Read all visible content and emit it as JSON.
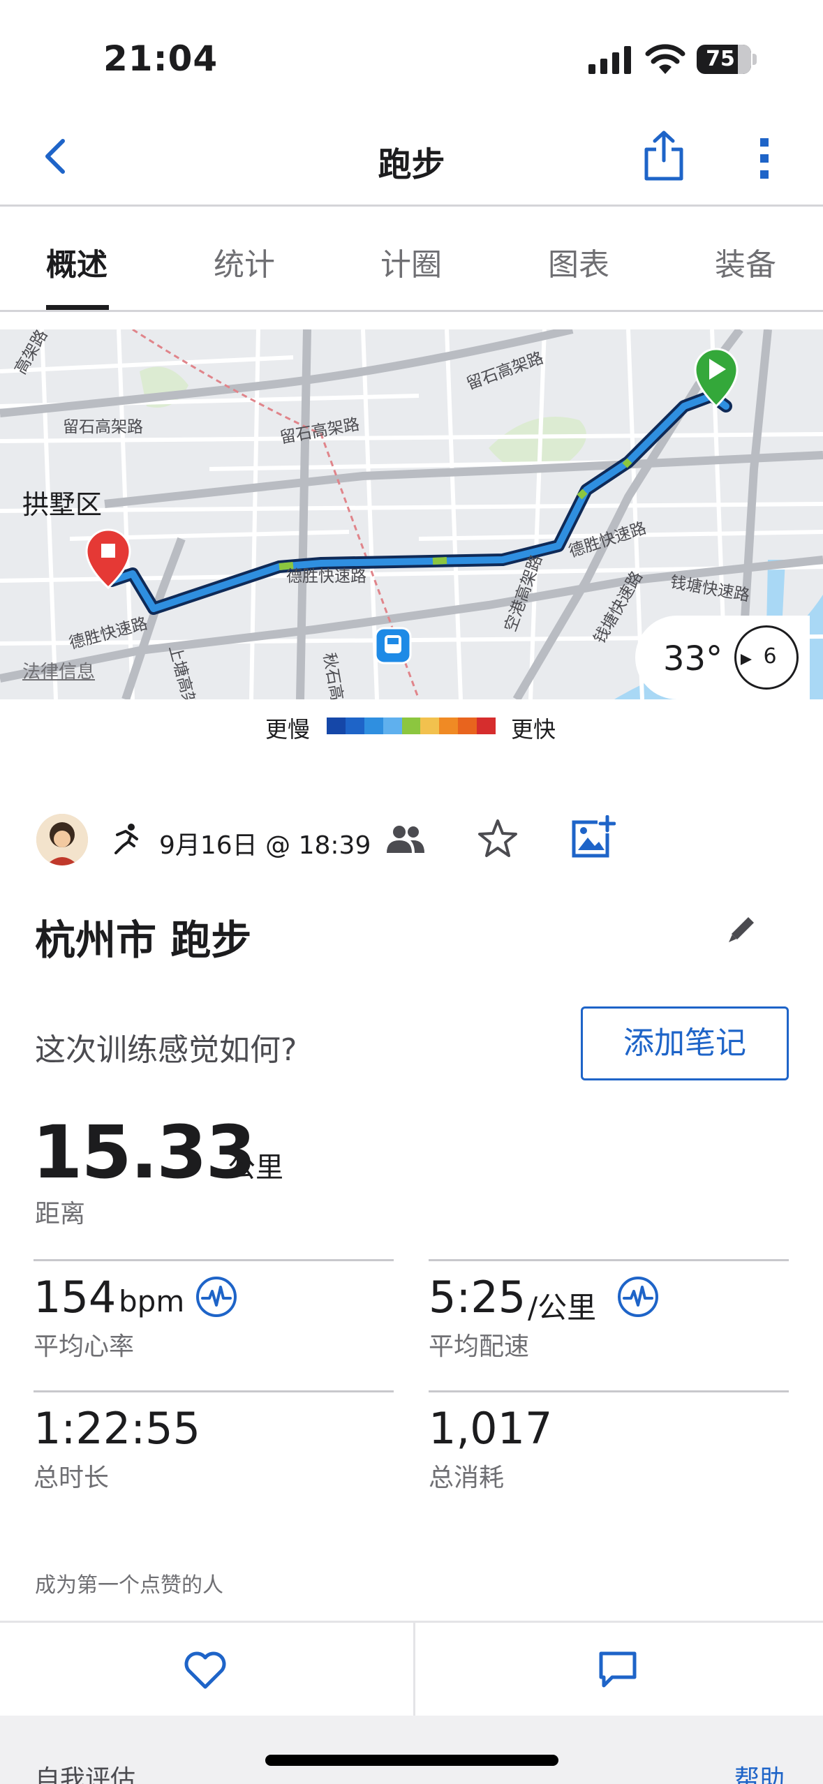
{
  "status_bar": {
    "time": "21:04",
    "battery": "75",
    "battery_level": 0.75
  },
  "nav": {
    "title": "跑步"
  },
  "tabs": [
    "概述",
    "统计",
    "计圈",
    "图表",
    "装备"
  ],
  "map": {
    "district": "拱墅区",
    "legal": "法律信息",
    "roads": [
      "留石高架路",
      "留石高架路",
      "留石高架路",
      "德胜快速路",
      "德胜快速路",
      "德胜快速路",
      "钱塘快速路",
      "钱塘快速路",
      "空港高架路",
      "上塘高架",
      "秋石高",
      "高架路"
    ],
    "weather_temp": "33°",
    "wind_speed": "6"
  },
  "legend": {
    "slow": "更慢",
    "fast": "更快",
    "colors": [
      "#1547a8",
      "#1e64c8",
      "#2f8fe0",
      "#5fb0ee",
      "#8cc63f",
      "#f2c14e",
      "#f08a24",
      "#e8641e",
      "#d62d2d"
    ]
  },
  "meta": {
    "date": "9月16日 @ 18:39"
  },
  "activity": {
    "title": "杭州市 跑步",
    "feel_question": "这次训练感觉如何?",
    "add_note": "添加笔记"
  },
  "stats": {
    "distance": {
      "value": "15.33",
      "unit": "公里",
      "label": "距离"
    },
    "heart_rate": {
      "value": "154",
      "unit": "bpm",
      "label": "平均心率"
    },
    "pace": {
      "value": "5:25",
      "unit": "/公里",
      "label": "平均配速"
    },
    "duration": {
      "value": "1:22:55",
      "label": "总时长"
    },
    "calories": {
      "value": "1,017",
      "label": "总消耗"
    }
  },
  "like_prompt": "成为第一个点赞的人",
  "bottom": {
    "self_eval": "自我评估",
    "help": "帮助"
  },
  "colors": {
    "accent": "#1e64c8",
    "route": "#1e64c8",
    "start": "#34a83a",
    "end": "#e53935"
  }
}
